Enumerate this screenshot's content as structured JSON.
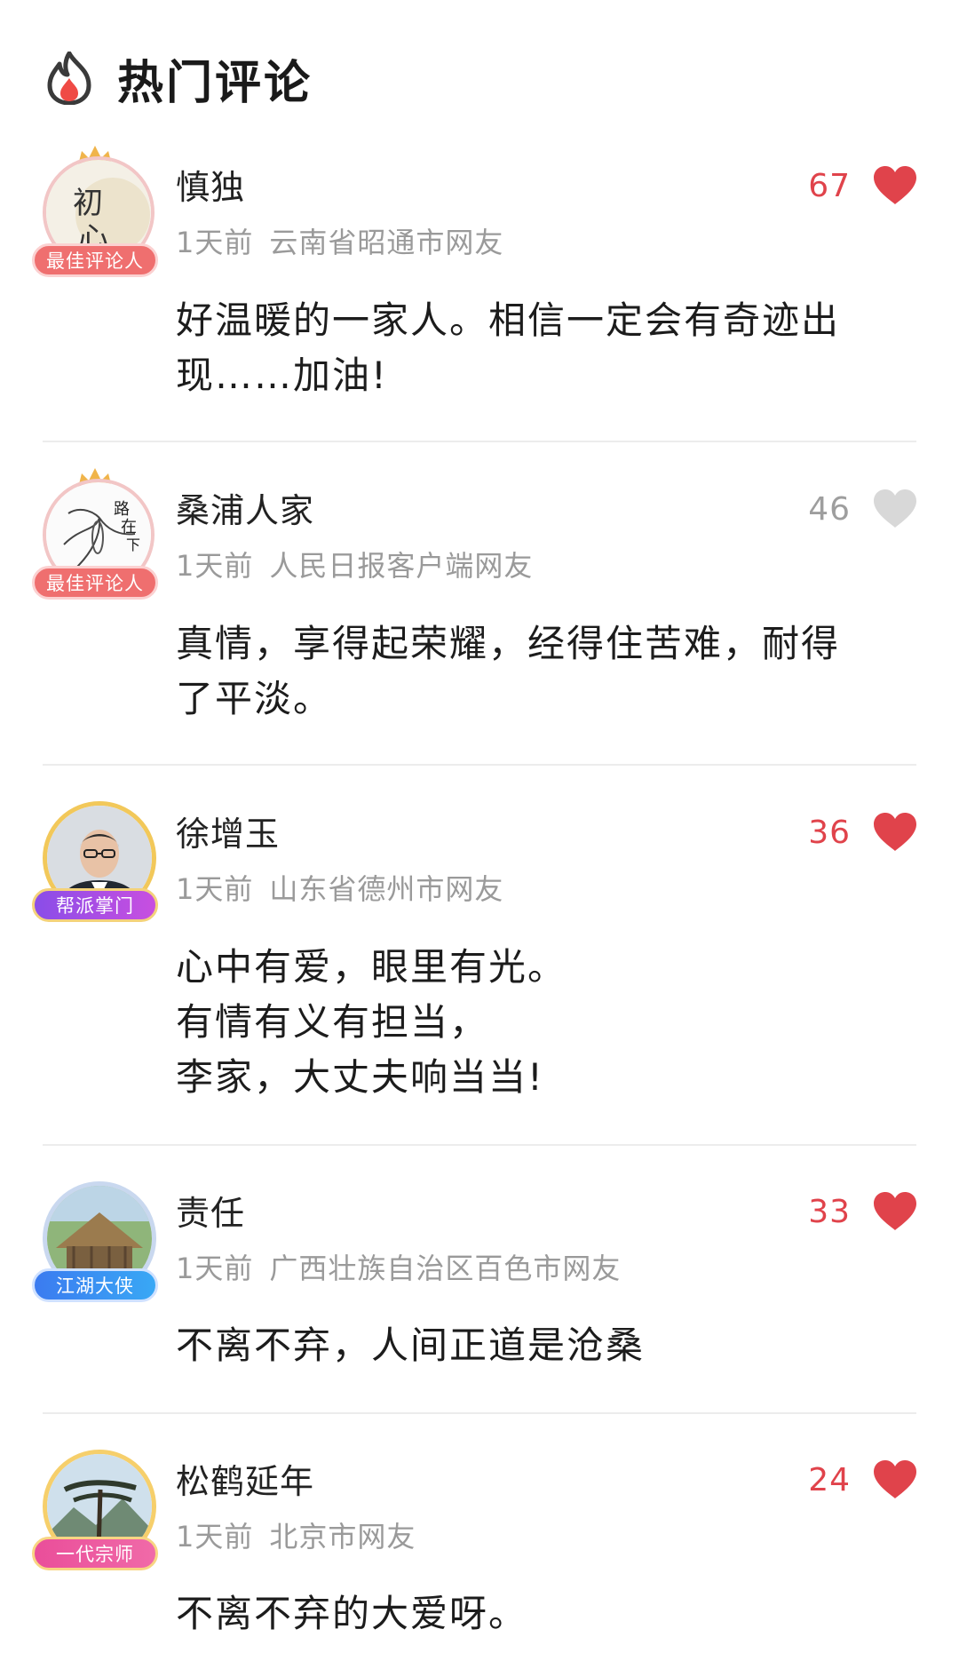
{
  "header": {
    "title": "热门评论",
    "icon": "flame-icon"
  },
  "colors": {
    "like_active": "#e0434b",
    "like_inactive": "#d8d8d8",
    "meta_gray": "#9a9a9a"
  },
  "comments": [
    {
      "username": "慎独",
      "time": "1天前",
      "location": "云南省昭通市网友",
      "content_lines": [
        "好温暖的一家人。相信一定会有奇迹出",
        "现……加油!"
      ],
      "likes": "67",
      "liked": true,
      "badge": "最佳评论人",
      "avatar_text": "初心"
    },
    {
      "username": "桑浦人家",
      "time": "1天前",
      "location": "人民日报客户端网友",
      "content_lines": [
        "真情，享得起荣耀，经得住苦难，耐得",
        "了平淡。"
      ],
      "likes": "46",
      "liked": false,
      "badge": "最佳评论人",
      "avatar_text": "路在脚下"
    },
    {
      "username": "徐增玉",
      "time": "1天前",
      "location": "山东省德州市网友",
      "content_lines": [
        "心中有爱，眼里有光。",
        "有情有义有担当，",
        "李家，大丈夫响当当!"
      ],
      "likes": "36",
      "liked": true,
      "badge": "帮派掌门"
    },
    {
      "username": "责任",
      "time": "1天前",
      "location": "广西壮族自治区百色市网友",
      "content_lines": [
        "不离不弃，人间正道是沧桑"
      ],
      "likes": "33",
      "liked": true,
      "badge": "江湖大侠"
    },
    {
      "username": "松鹤延年",
      "time": "1天前",
      "location": "北京市网友",
      "content_lines": [
        "不离不弃的大爱呀。"
      ],
      "likes": "24",
      "liked": true,
      "badge": "一代宗师"
    }
  ]
}
